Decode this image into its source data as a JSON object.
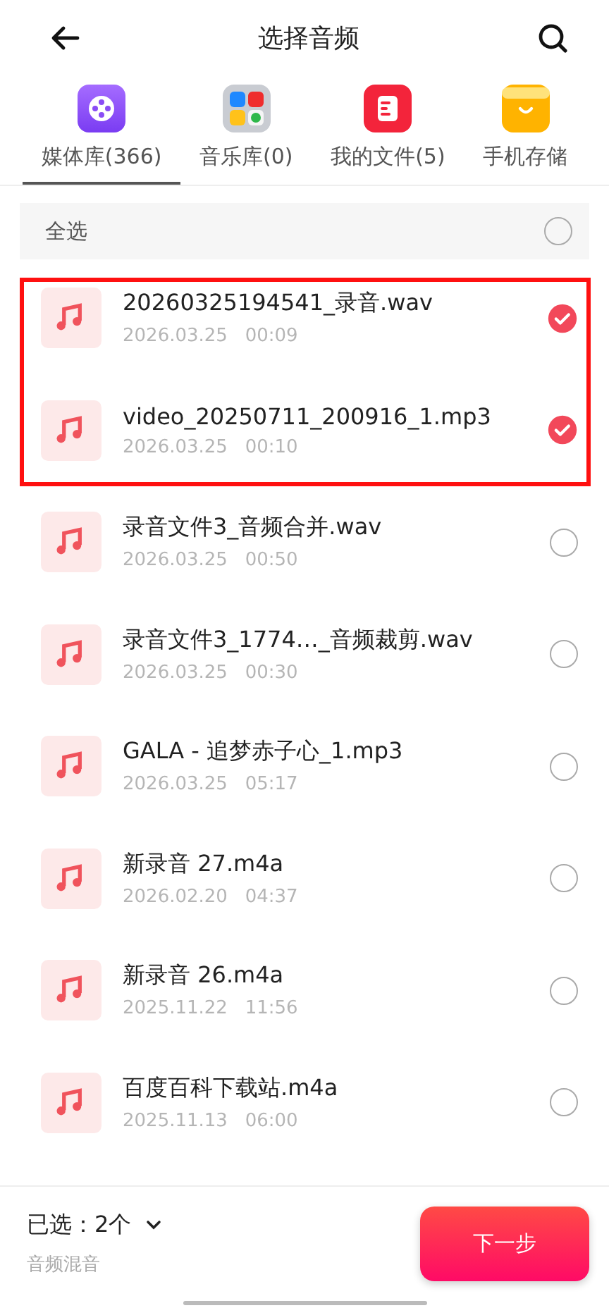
{
  "header": {
    "title": "选择音频"
  },
  "tabs": [
    {
      "label": "媒体库(366)",
      "selected": true
    },
    {
      "label": "音乐库(0)",
      "selected": false
    },
    {
      "label": "我的文件(5)",
      "selected": false
    },
    {
      "label": "手机存储",
      "selected": false
    }
  ],
  "select_all": {
    "label": "全选",
    "checked": false
  },
  "files": [
    {
      "name": "20260325194541_录音.wav",
      "date": "2026.03.25",
      "duration": "00:09",
      "checked": true
    },
    {
      "name": "video_20250711_200916_1.mp3",
      "date": "2026.03.25",
      "duration": "00:10",
      "checked": true
    },
    {
      "name": "录音文件3_音频合并.wav",
      "date": "2026.03.25",
      "duration": "00:50",
      "checked": false
    },
    {
      "name": "录音文件3_1774…_音频裁剪.wav",
      "date": "2026.03.25",
      "duration": "00:30",
      "checked": false
    },
    {
      "name": "GALA - 追梦赤子心_1.mp3",
      "date": "2026.03.25",
      "duration": "05:17",
      "checked": false
    },
    {
      "name": "新录音 27.m4a",
      "date": "2026.02.20",
      "duration": "04:37",
      "checked": false
    },
    {
      "name": "新录音 26.m4a",
      "date": "2025.11.22",
      "duration": "11:56",
      "checked": false
    },
    {
      "name": "百度百科下载站.m4a",
      "date": "2025.11.13",
      "duration": "06:00",
      "checked": false
    }
  ],
  "footer": {
    "selected_label": "已选：2个",
    "caption": "音频混音",
    "next_button": "下一步"
  }
}
